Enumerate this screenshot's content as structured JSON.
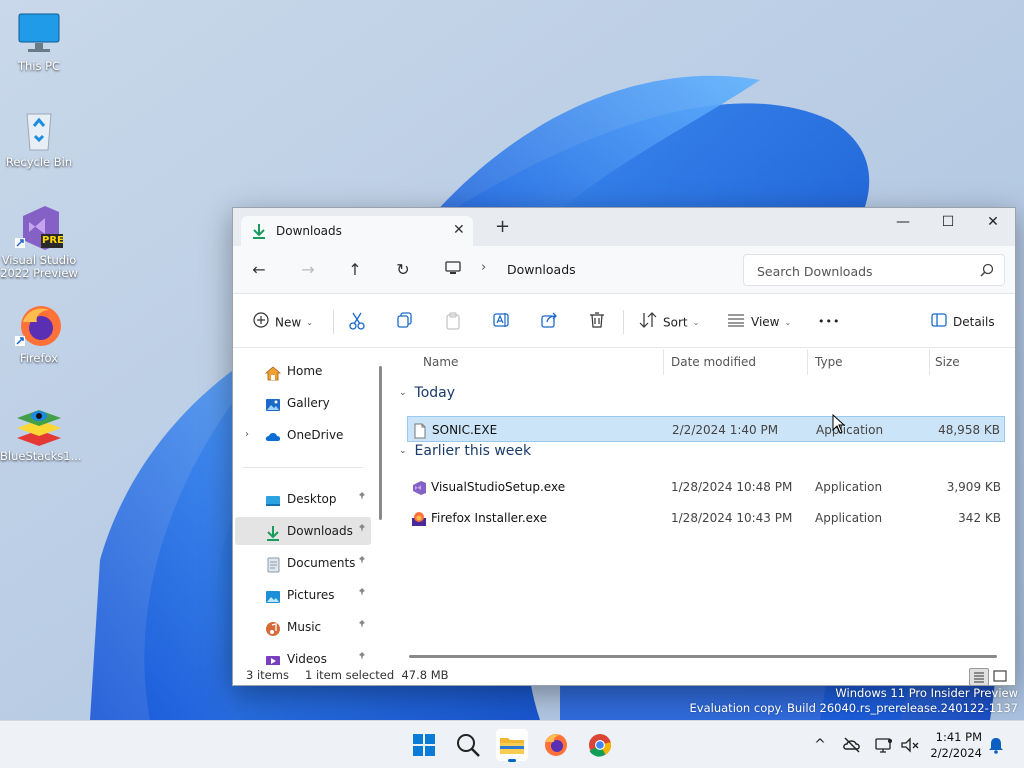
{
  "desktop": {
    "icons": [
      {
        "label": "This PC"
      },
      {
        "label": "Recycle Bin"
      },
      {
        "label": "Visual Studio 2022 Preview"
      },
      {
        "label": "Firefox"
      },
      {
        "label": "BlueStacks1..."
      }
    ],
    "vs_badge": "PRE"
  },
  "window": {
    "tab_title": "Downloads",
    "tab_close": "✕",
    "new_tab": "+",
    "minimize": "—",
    "maximize": "☐",
    "close": "✕",
    "nav": {
      "back": "←",
      "forward": "→",
      "up": "↑",
      "refresh": "↻",
      "sep": "›"
    },
    "breadcrumb": "Downloads",
    "search_placeholder": "Search Downloads",
    "toolbar": {
      "new_label": "New",
      "sort_label": "Sort",
      "view_label": "View",
      "more_label": "•••",
      "details_label": "Details",
      "chevron": "⌄"
    },
    "sidebar": {
      "items": [
        {
          "label": "Home"
        },
        {
          "label": "Gallery"
        },
        {
          "label": "OneDrive"
        },
        {
          "label": "Desktop"
        },
        {
          "label": "Downloads"
        },
        {
          "label": "Documents"
        },
        {
          "label": "Pictures"
        },
        {
          "label": "Music"
        },
        {
          "label": "Videos"
        }
      ],
      "expander": "›",
      "pin": "📌"
    },
    "columns": {
      "name": "Name",
      "date": "Date modified",
      "type": "Type",
      "size": "Size"
    },
    "groups": [
      {
        "label": "Today",
        "chev": "⌄"
      },
      {
        "label": "Earlier this week",
        "chev": "⌄"
      }
    ],
    "files": [
      {
        "name": "SONIC.EXE",
        "date": "2/2/2024 1:40 PM",
        "type": "Application",
        "size": "48,958 KB"
      },
      {
        "name": "VisualStudioSetup.exe",
        "date": "1/28/2024 10:48 PM",
        "type": "Application",
        "size": "3,909 KB"
      },
      {
        "name": "Firefox Installer.exe",
        "date": "1/28/2024 10:43 PM",
        "type": "Application",
        "size": "342 KB"
      }
    ],
    "status": {
      "count": "3 items",
      "selected": "1 item selected  47.8 MB"
    }
  },
  "watermark": {
    "line1": "Windows 11 Pro Insider Preview",
    "line2": "Evaluation copy. Build 26040.rs_prerelease.240122-1137"
  },
  "taskbar": {
    "time": "1:41 PM",
    "date": "2/2/2024",
    "tray_chevron": "^"
  },
  "colors": {
    "accent": "#0067c0",
    "selection": "#cce4f7",
    "wallpaper": "#1f6fe0"
  }
}
